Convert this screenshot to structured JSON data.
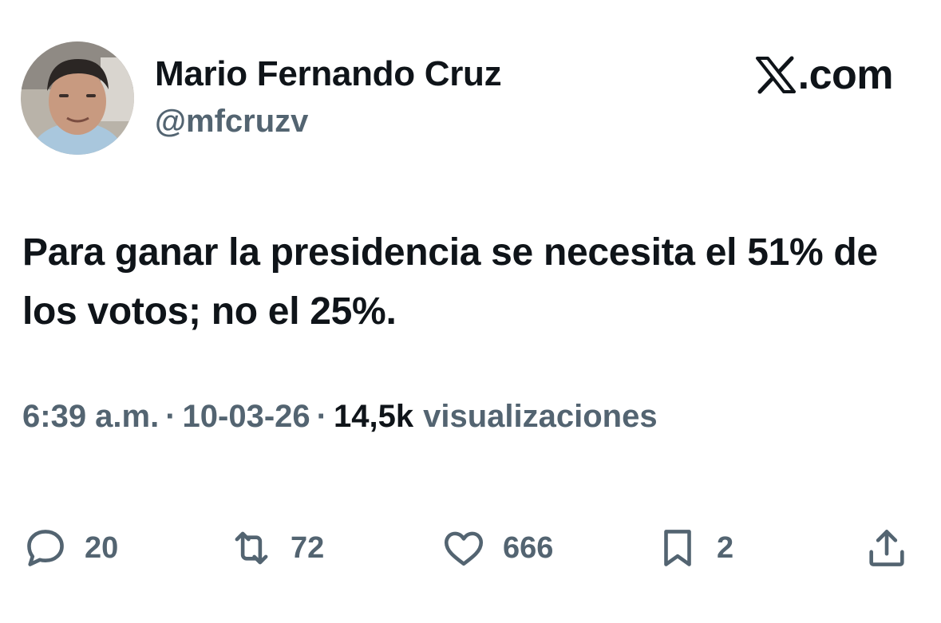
{
  "author": {
    "display_name": "Mario Fernando Cruz",
    "handle": "@mfcruzv"
  },
  "brand": {
    "text": ".com",
    "icon": "x-logo-icon"
  },
  "tweet": {
    "text": "Para ganar la presidencia se necesita el 51% de los votos; no el 25%."
  },
  "meta": {
    "time": "6:39 a.m.",
    "separator": "·",
    "date": "10-03-26",
    "views_count": "14,5k",
    "views_label": "visualizaciones"
  },
  "actions": {
    "reply": {
      "icon": "reply-icon",
      "count": "20"
    },
    "retweet": {
      "icon": "retweet-icon",
      "count": "72"
    },
    "like": {
      "icon": "heart-icon",
      "count": "666"
    },
    "bookmark": {
      "icon": "bookmark-icon",
      "count": "2"
    },
    "share": {
      "icon": "share-icon"
    }
  },
  "colors": {
    "text_primary": "#0f1419",
    "text_secondary": "#536471",
    "background": "#ffffff"
  }
}
